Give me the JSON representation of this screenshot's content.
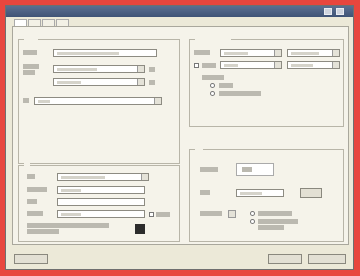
{
  "window": {
    "title": ""
  },
  "tabs": [
    {
      "label": ""
    },
    {
      "label": ""
    },
    {
      "label": ""
    },
    {
      "label": ""
    }
  ],
  "buttons": {
    "help": "",
    "ok": "",
    "cancel": ""
  }
}
